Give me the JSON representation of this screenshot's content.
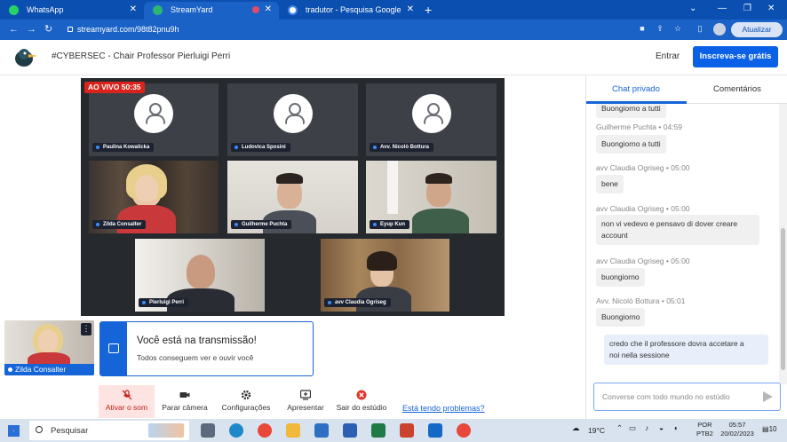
{
  "browser": {
    "tabs": [
      {
        "title": "WhatsApp",
        "icon": "whatsapp-icon",
        "color": "#25d366"
      },
      {
        "title": "StreamYard",
        "icon": "streamyard-icon",
        "color": "#2bb673"
      },
      {
        "title": "tradutor - Pesquisa Google",
        "icon": "google-icon",
        "color": "#4285f4"
      }
    ],
    "url": "streamyard.com/98t82pnu9h",
    "update_label": "Atualizar"
  },
  "header": {
    "event_title": "#CYBERSEC - Chair Professor Pierluigi Perri",
    "enter_label": "Entrar",
    "signup_label": "Inscreva-se grátis"
  },
  "stage": {
    "live_label": "AO VIVO 50:35",
    "participants": [
      {
        "name": "Paulina Kowalicka",
        "camera": false
      },
      {
        "name": "Ludovica Sposini",
        "camera": false
      },
      {
        "name": "Avv. Nicolò Bottura",
        "camera": false
      },
      {
        "name": "Zilda Consalter",
        "camera": true
      },
      {
        "name": "Guilherme Puchta",
        "camera": true
      },
      {
        "name": "Eyup Kun",
        "camera": true
      },
      {
        "name": "Pierluigi Perri",
        "camera": true
      },
      {
        "name": "avv Claudia Ogriseg",
        "camera": true
      }
    ]
  },
  "self_view": {
    "name": "Zilda Consalter",
    "more_label": "⋮"
  },
  "status_card": {
    "title": "Você está na transmissão!",
    "subtitle": "Todos conseguem ver e ouvir você"
  },
  "controls": {
    "unmute_label": "Ativar o som",
    "camera_label": "Parar câmera",
    "settings_label": "Configurações",
    "present_label": "Apresentar",
    "leave_label": "Sair do estúdio",
    "trouble_label": "Está tendo problemas?"
  },
  "chat": {
    "tab_private": "Chat privado",
    "tab_comments": "Comentários",
    "messages": [
      {
        "author": "",
        "time": "",
        "text": "Buongiorno a tutti"
      },
      {
        "author": "Guilherme Puchta",
        "time": "04:59",
        "text": "Buongiorno a tutti"
      },
      {
        "author": "avv Claudia Ogriseg",
        "time": "05:00",
        "text": "bene"
      },
      {
        "author": "avv Claudia Ogriseg",
        "time": "05:00",
        "text_line1": "non vi vedevo e pensavo di dover creare",
        "text_line2": "account"
      },
      {
        "author": "avv Claudia Ogriseg",
        "time": "05:00",
        "text": "buongiorno"
      },
      {
        "author": "Avv. Nicolò Bottura",
        "time": "05:01",
        "text": "Buongiorno"
      },
      {
        "author": "",
        "time": "",
        "text_line1": "credo che il professore dovra accetare a",
        "text_line2": "noi nella sessione",
        "own": true
      }
    ],
    "input_placeholder": "Converse com todo mundo no estúdio"
  },
  "taskbar": {
    "search_label": "Pesquisar",
    "weather": "19°C",
    "lang_line1": "POR",
    "lang_line2": "PTB2",
    "time": "05:57",
    "date": "20/02/2023",
    "notifications": "10"
  }
}
